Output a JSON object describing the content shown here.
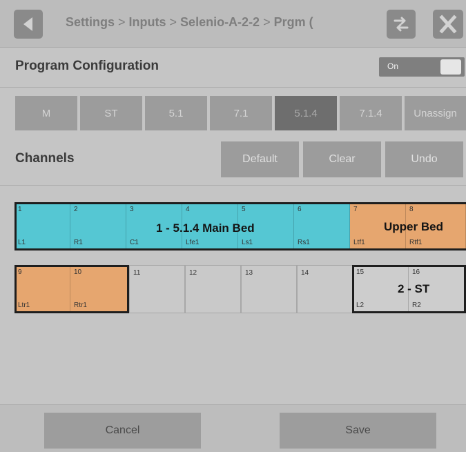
{
  "header": {
    "crumbs": [
      "Settings",
      "Inputs",
      "Selenio-A-2-2",
      "Prgm ("
    ],
    "separator": ">"
  },
  "program_config": {
    "title": "Program Configuration",
    "toggle_label": "On"
  },
  "formats": [
    {
      "label": "M"
    },
    {
      "label": "ST"
    },
    {
      "label": "5.1"
    },
    {
      "label": "7.1"
    },
    {
      "label": "5.1.4"
    },
    {
      "label": "7.1.4"
    },
    {
      "label": "Unassign"
    }
  ],
  "channels": {
    "title": "Channels",
    "actions": [
      "Default",
      "Clear",
      "Undo"
    ],
    "row1": [
      {
        "num": "1",
        "ch": "L1"
      },
      {
        "num": "2",
        "ch": "R1"
      },
      {
        "num": "3",
        "ch": "C1"
      },
      {
        "num": "4",
        "ch": "Lfe1"
      },
      {
        "num": "5",
        "ch": "Ls1"
      },
      {
        "num": "6",
        "ch": "Rs1"
      },
      {
        "num": "7",
        "ch": "Ltf1"
      },
      {
        "num": "8",
        "ch": "Rtf1"
      }
    ],
    "row2": [
      {
        "num": "9",
        "ch": "Ltr1"
      },
      {
        "num": "10",
        "ch": "Rtr1"
      },
      {
        "num": "11",
        "ch": ""
      },
      {
        "num": "12",
        "ch": ""
      },
      {
        "num": "13",
        "ch": ""
      },
      {
        "num": "14",
        "ch": ""
      },
      {
        "num": "15",
        "ch": "L2"
      },
      {
        "num": "16",
        "ch": "R2"
      }
    ],
    "groups": {
      "main_bed": "1 - 5.1.4 Main Bed",
      "upper_bed": "Upper Bed",
      "stereo": "2 - ST"
    }
  },
  "footer": {
    "cancel": "Cancel",
    "save": "Save"
  },
  "colors": {
    "main_bed": "#55c7d3",
    "upper_bed": "#e6a66f",
    "selected_format": "#6e6e6e"
  }
}
